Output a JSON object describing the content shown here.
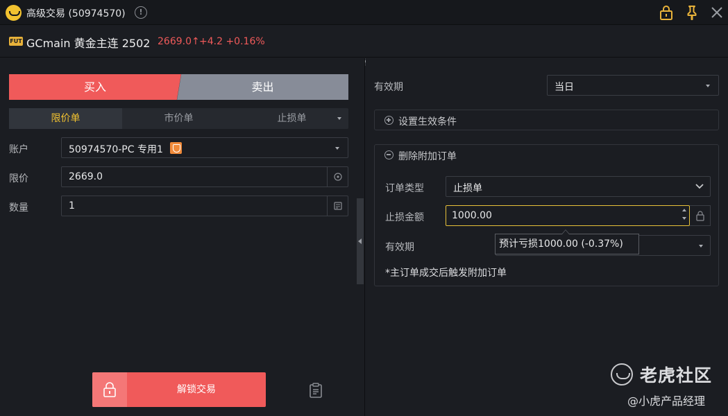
{
  "window": {
    "title": "高级交易 (50974570)",
    "info_icon": "!"
  },
  "symbol": {
    "badge": "FUT",
    "name": "GCmain 黄金主连 2502",
    "price": "2669.0",
    "change": "+4.2",
    "change_pct": "+0.16%"
  },
  "trade": {
    "buy_label": "买入",
    "sell_label": "卖出"
  },
  "order_types": {
    "limit": "限价单",
    "market": "市价单",
    "stop": "止损单"
  },
  "fields": {
    "account_label": "账户",
    "account_value": "50974570-PC 专用1",
    "limit_label": "限价",
    "limit_value": "2669.0",
    "qty_label": "数量",
    "qty_value": "1"
  },
  "unlock": {
    "label": "解锁交易"
  },
  "right": {
    "validity_label": "有效期",
    "validity_value": "当日",
    "set_condition_label": "设置生效条件",
    "remove_attached_label": "删除附加订单",
    "order_type_label": "订单类型",
    "order_type_value": "止损单",
    "stop_amount_label": "止损金额",
    "stop_amount_value": "1000.00",
    "attached_validity_label": "有效期",
    "tooltip": "预计亏损1000.00  (-0.37%)",
    "note": "*主订单成交后触发附加订单"
  },
  "watermark": {
    "title": "老虎社区",
    "subtitle": "@小虎产品经理"
  },
  "colors": {
    "buy": "#f05a5a",
    "sell": "#878c98",
    "accent": "#f2c230",
    "background": "#1b1d22"
  }
}
